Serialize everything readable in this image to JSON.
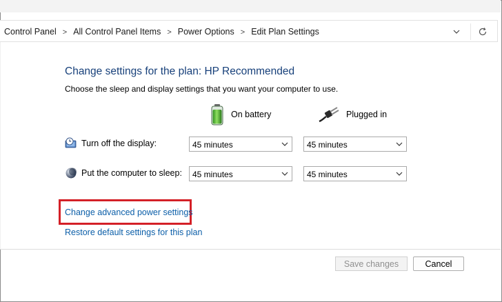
{
  "breadcrumb": {
    "items": [
      "Control Panel",
      "All Control Panel Items",
      "Power Options",
      "Edit Plan Settings"
    ],
    "separator": ">"
  },
  "icons": {
    "address_dropdown": "chevron-down-icon",
    "refresh": "refresh-icon",
    "battery": "battery-icon",
    "plug": "power-plug-icon",
    "display": "display-timer-icon",
    "sleep": "sleep-moon-icon"
  },
  "main": {
    "title": "Change settings for the plan: HP Recommended",
    "description": "Choose the sleep and display settings that you want your computer to use.",
    "columns": {
      "battery": "On battery",
      "plugged": "Plugged in"
    },
    "rows": [
      {
        "label": "Turn off the display:",
        "battery_value": "45 minutes",
        "plugged_value": "45 minutes"
      },
      {
        "label": "Put the computer to sleep:",
        "battery_value": "45 minutes",
        "plugged_value": "45 minutes"
      }
    ],
    "links": {
      "advanced": "Change advanced power settings",
      "restore": "Restore default settings for this plan"
    }
  },
  "footer": {
    "save_label": "Save changes",
    "cancel_label": "Cancel"
  },
  "colors": {
    "title": "#17407a",
    "link": "#0b5ea8",
    "highlight_box": "#d42027",
    "save_disabled_text": "#8f8f8f"
  }
}
